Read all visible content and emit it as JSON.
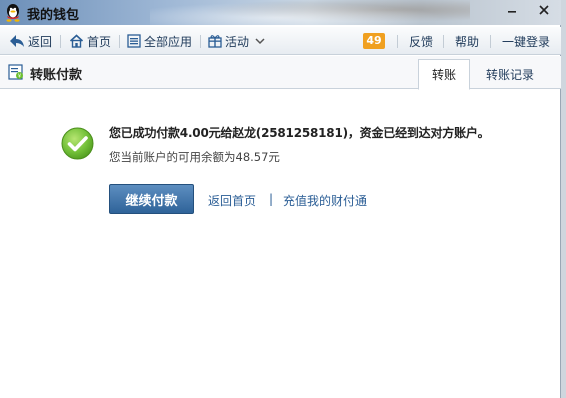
{
  "window": {
    "title": "我的钱包",
    "minimize_icon": "minimize-icon",
    "close_icon": "close-icon"
  },
  "nav": {
    "back_label": "返回",
    "home_label": "首页",
    "apps_label": "全部应用",
    "activity_label": "活动",
    "badge_count": "49",
    "feedback_label": "反馈",
    "help_label": "帮助",
    "login_label": "一键登录"
  },
  "header": {
    "title": "转账付款",
    "tabs": [
      {
        "label": "转账",
        "active": true
      },
      {
        "label": "转账记录",
        "active": false
      }
    ]
  },
  "result": {
    "message": "您已成功付款4.00元给赵龙(2581258181)，资金已经到达对方账户。",
    "balance_text": "您当前账户的可用余额为48.57元",
    "continue_button": "继续付款",
    "home_link": "返回首页",
    "separator": "|",
    "recharge_link": "充值我的财付通"
  },
  "colors": {
    "accent": "#2f6399",
    "link": "#2a5d95",
    "badge": "#f0a020",
    "success": "#6cbf2f"
  }
}
